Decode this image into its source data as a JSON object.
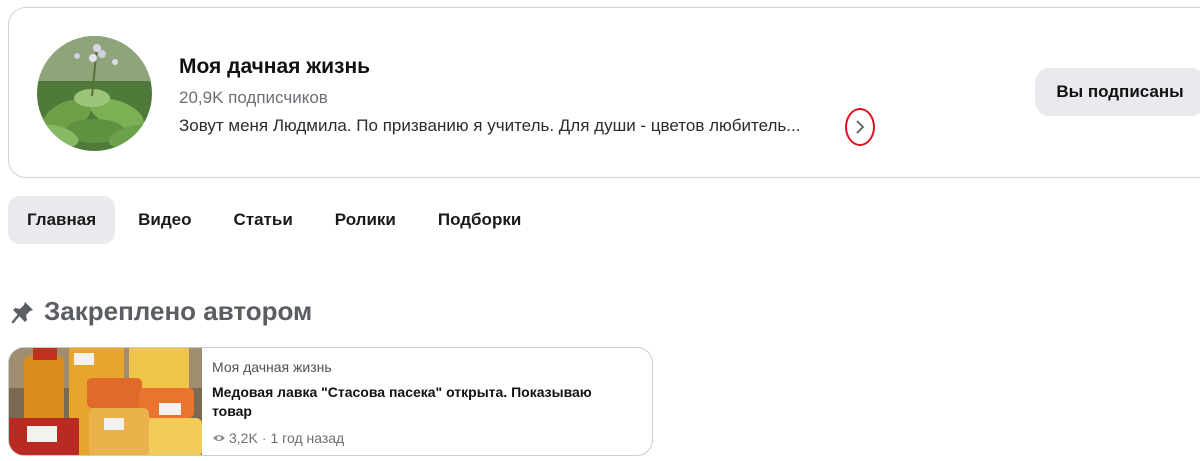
{
  "channel": {
    "title": "Моя дачная жизнь",
    "subscribers": "20,9K подписчиков",
    "description": "Зовут меня Людмила. По призванию я учитель. Для души - цветов любитель...",
    "subscribe_label": "Вы подписаны",
    "expand_icon": "chevron-right-icon",
    "highlight_color": "#e0101e"
  },
  "tabs": [
    {
      "label": "Главная",
      "active": true
    },
    {
      "label": "Видео",
      "active": false
    },
    {
      "label": "Статьи",
      "active": false
    },
    {
      "label": "Ролики",
      "active": false
    },
    {
      "label": "Подборки",
      "active": false
    }
  ],
  "pinned": {
    "icon": "pin-icon",
    "title": "Закреплено автором",
    "card": {
      "source": "Моя дачная жизнь",
      "title": "Медовая лавка \"Стасова пасека\" открыта. Показываю товар",
      "views": "3,2K",
      "separator": "·",
      "age": "1 год назад"
    }
  }
}
